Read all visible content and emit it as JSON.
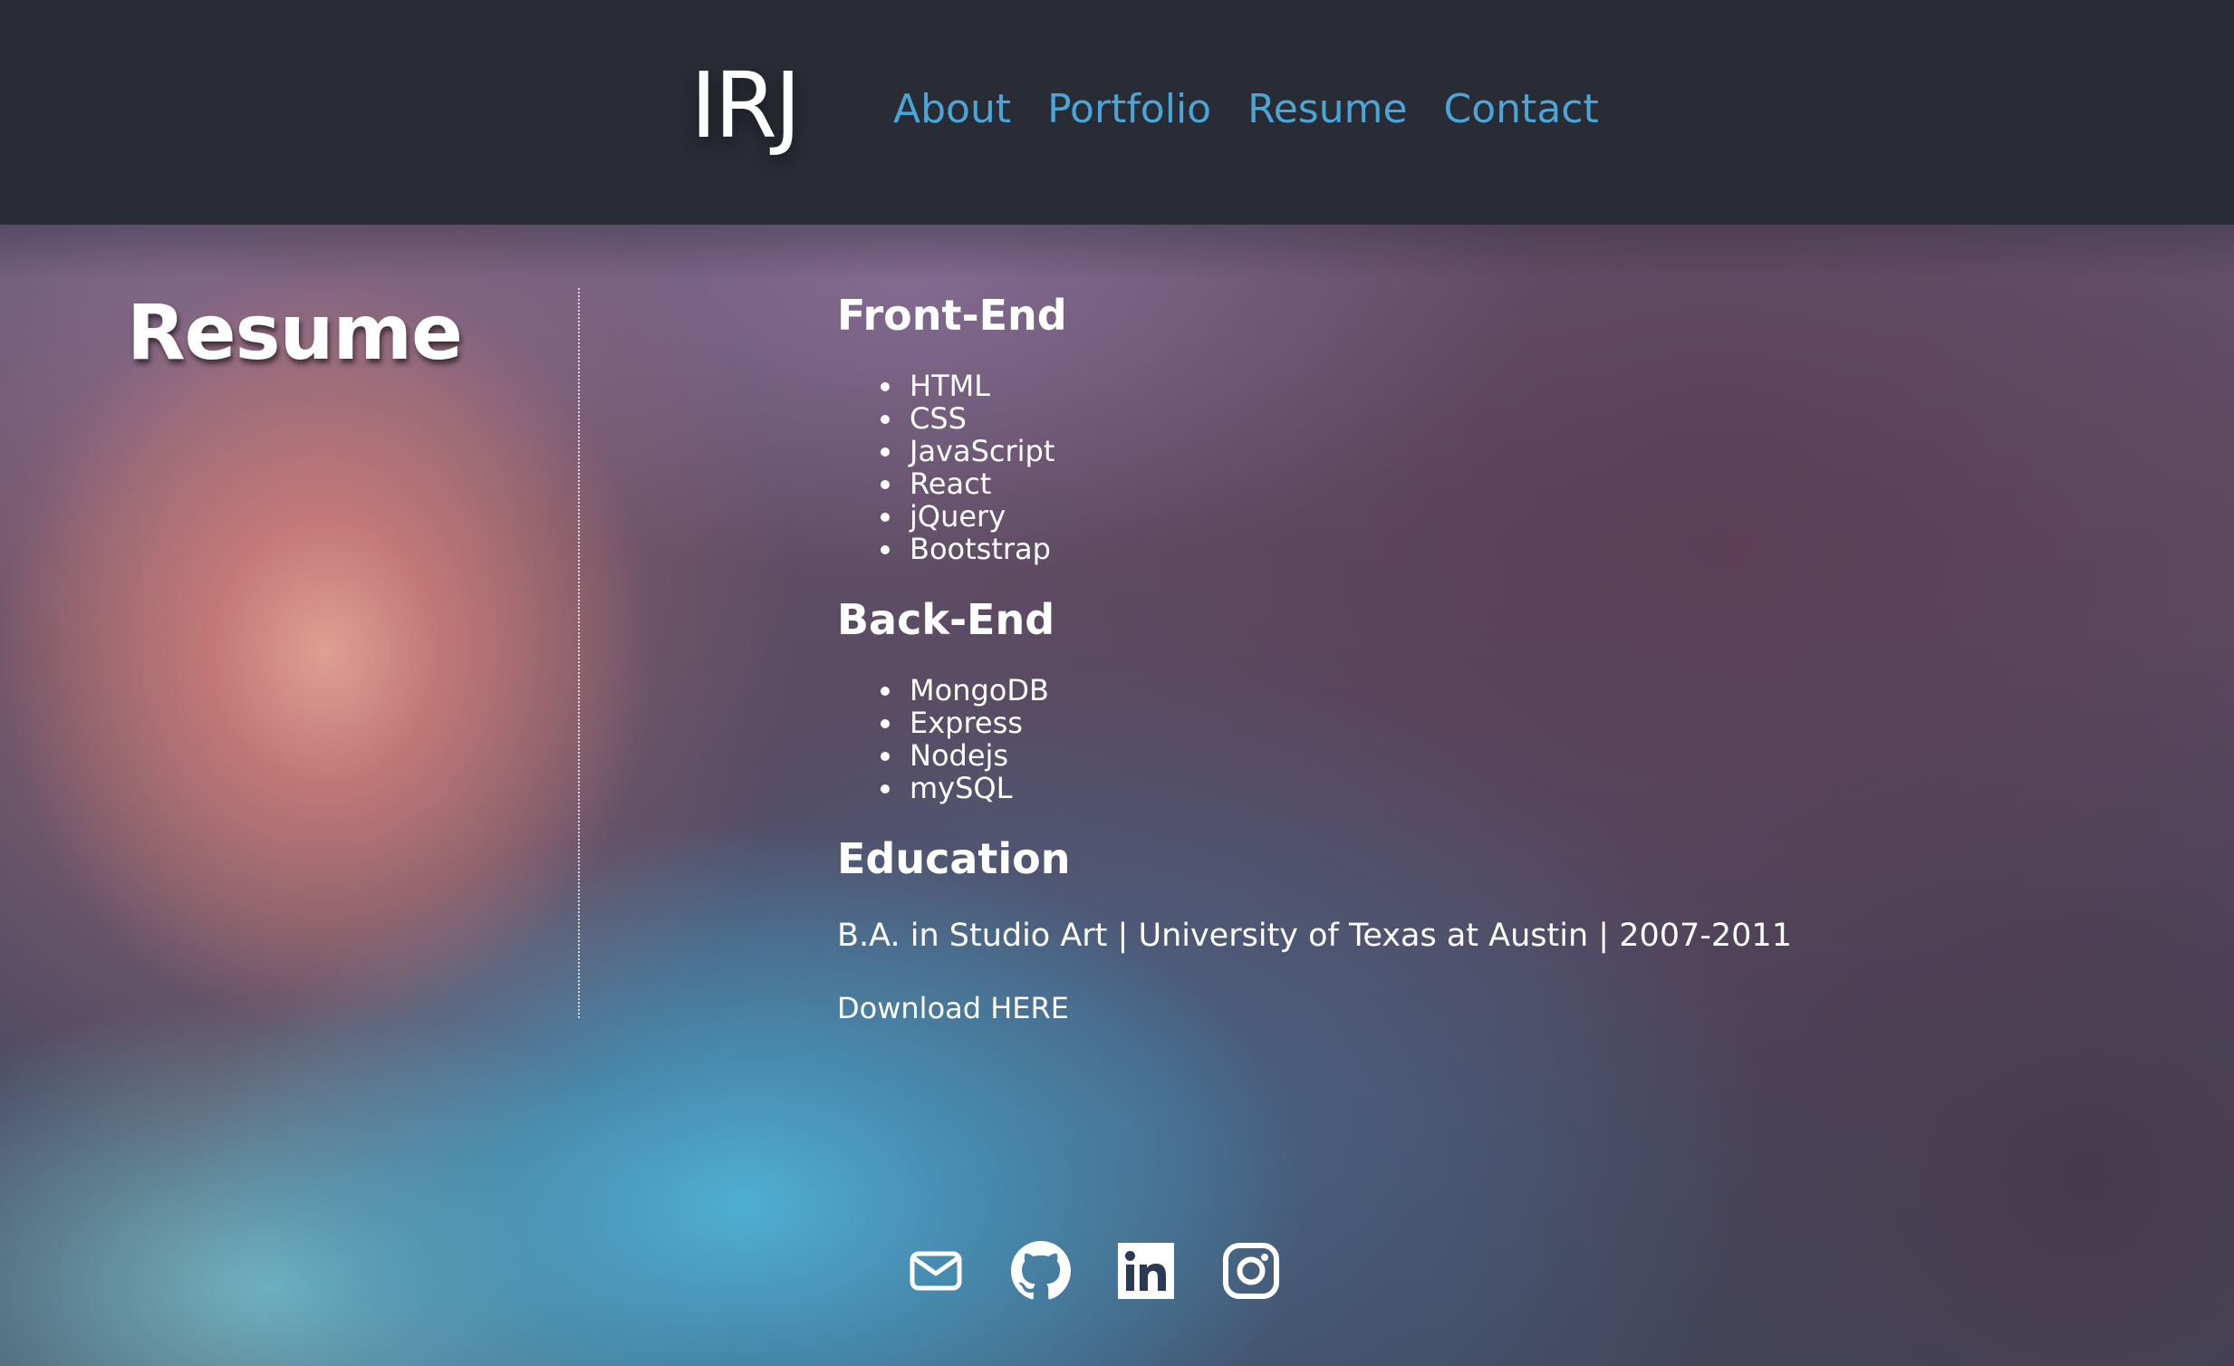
{
  "header": {
    "logo": "IRJ",
    "nav": [
      {
        "label": "About"
      },
      {
        "label": "Portfolio"
      },
      {
        "label": "Resume"
      },
      {
        "label": "Contact"
      }
    ],
    "nav_color": "#4aa5d8",
    "background": "#292c35"
  },
  "main": {
    "title": "Resume",
    "frontend": {
      "heading": "Front-End",
      "items": [
        "HTML",
        "CSS",
        "JavaScript",
        "React",
        "jQuery",
        "Bootstrap"
      ]
    },
    "backend": {
      "heading": "Back-End",
      "items": [
        "MongoDB",
        "Express",
        "Nodejs",
        "mySQL"
      ]
    },
    "education": {
      "heading": "Education",
      "text": "B.A. in Studio Art | University of Texas at Austin | 2007-2011"
    },
    "download": "Download HERE"
  },
  "footer": {
    "icons": [
      "envelope-icon",
      "github-icon",
      "linkedin-icon",
      "instagram-icon"
    ]
  }
}
